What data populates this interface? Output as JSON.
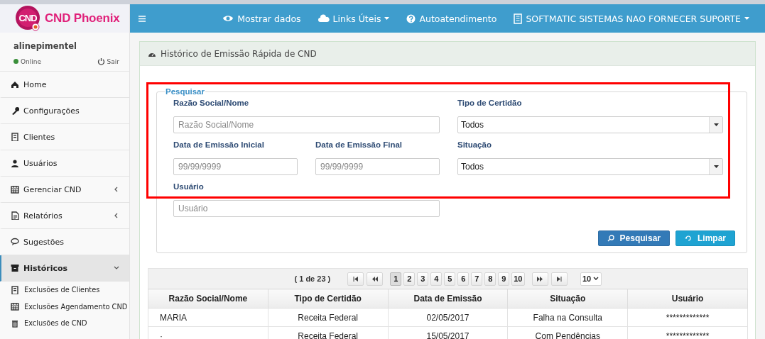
{
  "brand": {
    "logo_text": "CND",
    "name": "CND Phoenix"
  },
  "user": {
    "name": "alinepimentel",
    "status": "Online",
    "online": true,
    "logout": "Sair"
  },
  "menu": [
    {
      "label": "Home",
      "kind": "link",
      "selected": false
    },
    {
      "label": "Configurações",
      "kind": "link",
      "selected": false
    },
    {
      "label": "Clientes",
      "kind": "link",
      "selected": false
    },
    {
      "label": "Usuários",
      "kind": "link",
      "selected": false
    },
    {
      "label": "Gerenciar CND",
      "kind": "group",
      "selected": false,
      "expanded": false
    },
    {
      "label": "Relatórios",
      "kind": "group",
      "selected": false,
      "expanded": false
    },
    {
      "label": "Sugestões",
      "kind": "link",
      "selected": false
    },
    {
      "label": "Históricos",
      "kind": "group",
      "selected": true,
      "expanded": true,
      "children": [
        {
          "label": "Exclusões de Clientes"
        },
        {
          "label": "Exclusões Agendamento CND"
        },
        {
          "label": "Exclusões de CND"
        }
      ]
    }
  ],
  "topbar": [
    {
      "label": "Mostrar dados",
      "dropdown": false
    },
    {
      "label": "Links Úteis",
      "dropdown": true
    },
    {
      "label": "Autoatendimento",
      "dropdown": false
    },
    {
      "label": "SOFTMATIC SISTEMAS NAO FORNECER SUPORTE",
      "dropdown": true
    }
  ],
  "panel": {
    "title": "Histórico de Emissão Rápida de CND"
  },
  "search": {
    "legend": "Pesquisar",
    "highlighted": true,
    "fields": [
      {
        "kind": "text",
        "label": "Razão Social/Nome",
        "placeholder": "Razão Social/Nome"
      },
      {
        "kind": "select",
        "label": "Tipo de Certidão",
        "value": "Todos"
      },
      {
        "kind": "text",
        "label": "Data de Emissão Inicial",
        "placeholder": "99/99/9999"
      },
      {
        "kind": "text",
        "label": "Data de Emissão Final",
        "placeholder": "99/99/9999"
      },
      {
        "kind": "select",
        "label": "Situação",
        "value": "Todos"
      },
      {
        "kind": "text",
        "label": "Usuário",
        "placeholder": "Usuário"
      }
    ],
    "buttons": [
      {
        "label": "Pesquisar",
        "kind": "primary"
      },
      {
        "label": "Limpar",
        "kind": "info"
      }
    ]
  },
  "pager": {
    "summary": "( 1 de 23 )",
    "pages": [
      {
        "label": "1",
        "selected": true
      },
      {
        "label": "2",
        "selected": false
      },
      {
        "label": "3",
        "selected": false
      },
      {
        "label": "4",
        "selected": false
      },
      {
        "label": "5",
        "selected": false
      },
      {
        "label": "6",
        "selected": false
      },
      {
        "label": "7",
        "selected": false
      },
      {
        "label": "8",
        "selected": false
      },
      {
        "label": "9",
        "selected": false
      },
      {
        "label": "10",
        "selected": false
      }
    ],
    "page_size": "10"
  },
  "table": {
    "columns": [
      "Razão Social/Nome",
      "Tipo de Certidão",
      "Data de Emissão",
      "Situação",
      "Usuário"
    ],
    "rows": [
      [
        "MARIA",
        "Receita Federal",
        "02/05/2017",
        "Falha na Consulta",
        "*************"
      ],
      [
        "·",
        "Receita Federal",
        "15/05/2017",
        "Com Pendências",
        "*************"
      ]
    ]
  }
}
